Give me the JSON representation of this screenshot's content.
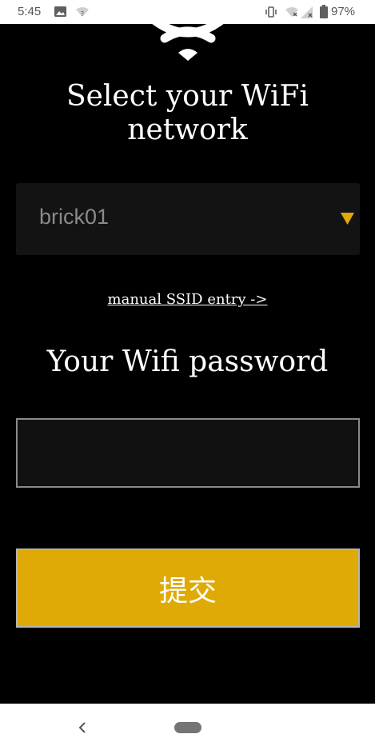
{
  "status_bar": {
    "time": "5:45",
    "battery": "97%",
    "icons": [
      "image-icon",
      "wifi-question-icon",
      "vibrate-icon",
      "wifi-x-icon",
      "signal-icon",
      "battery-icon"
    ]
  },
  "main": {
    "hero_icon": "wifi-icon",
    "title_line1": "Select your WiFi",
    "title_line2": "network",
    "network_select": {
      "selected": "brick01",
      "arrow_icon": "triangle-down-icon"
    },
    "manual_link": "manual SSID entry ->",
    "password_label": "Your Wifi password",
    "password_value": "",
    "submit_label": "提交"
  },
  "nav_bar": {
    "icons": [
      "back-icon",
      "home-pill"
    ]
  },
  "colors": {
    "background": "#000000",
    "accent": "#dfaa06",
    "select_bg": "#131313",
    "input_border": "#8a8a8a"
  }
}
